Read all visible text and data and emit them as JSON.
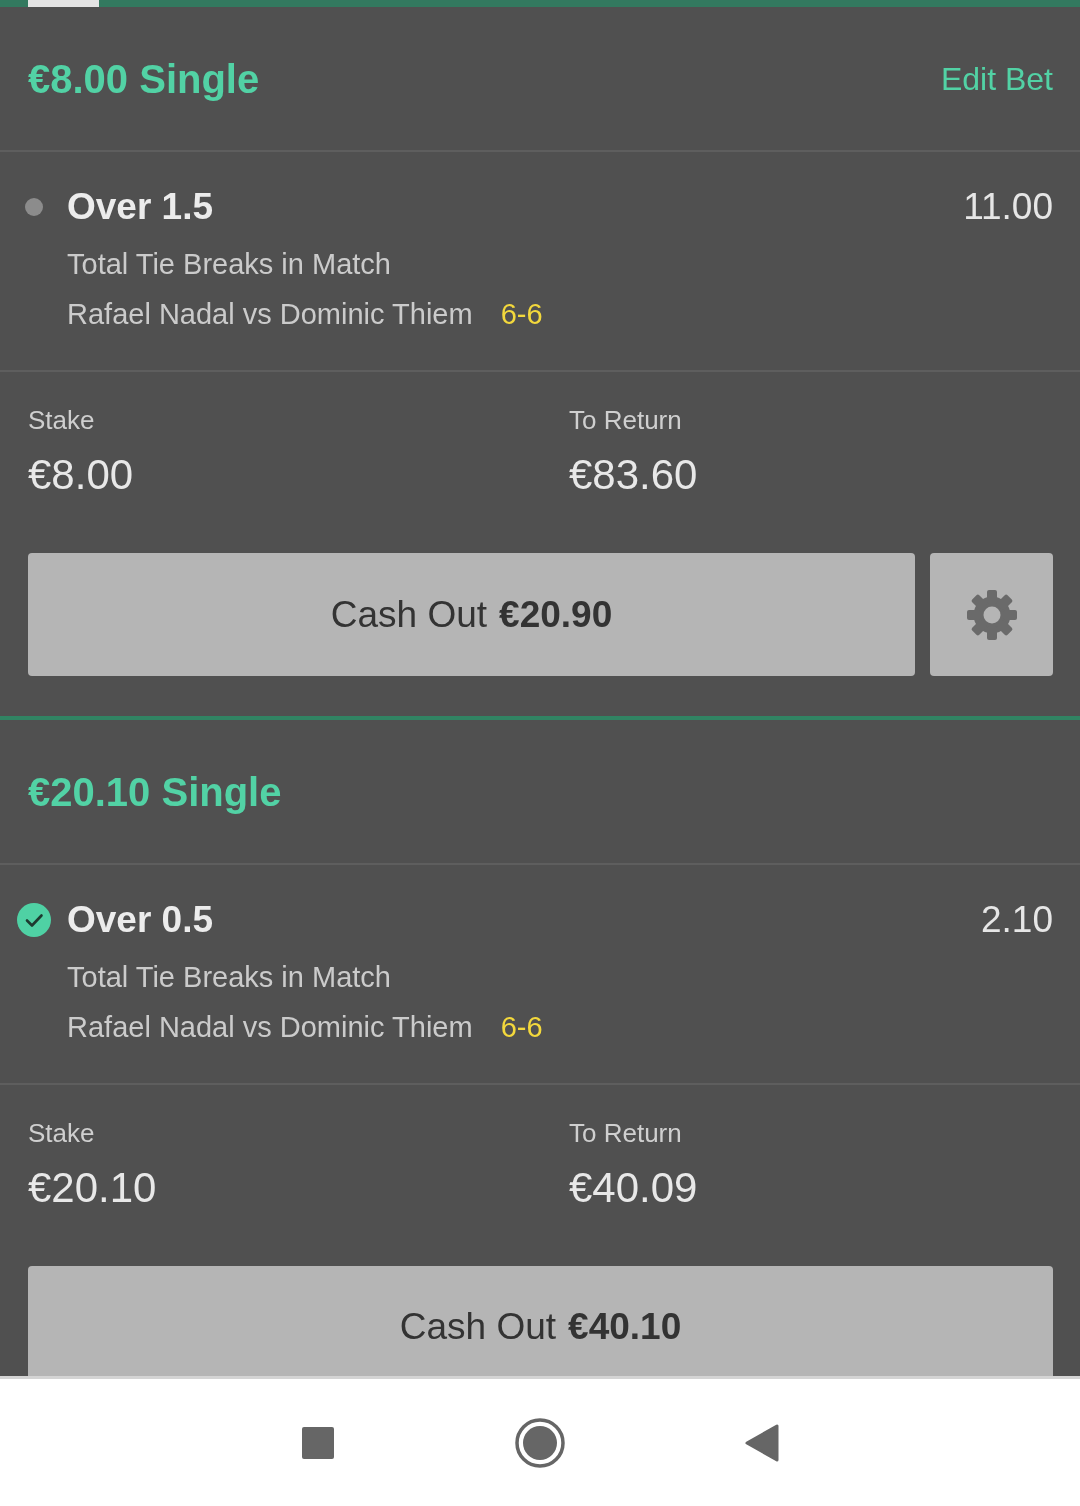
{
  "bets": [
    {
      "title": "€8.00 Single",
      "edit_link": "Edit Bet",
      "selection": {
        "name": "Over 1.5",
        "odds": "11.00",
        "market": "Total Tie Breaks in Match",
        "event": "Rafael Nadal vs Dominic Thiem",
        "score": "6-6",
        "won": false
      },
      "stake": {
        "label": "Stake",
        "value": "€8.00"
      },
      "to_return": {
        "label": "To Return",
        "value": "€83.60"
      },
      "cash_out": "Cash Out **€20.90**",
      "settings_button": true
    },
    {
      "title": "€20.10 Single",
      "selection": {
        "name": "Over 0.5",
        "odds": "2.10",
        "market": "Total Tie Breaks in Match",
        "event": "Rafael Nadal vs Dominic Thiem",
        "score": "6-6",
        "won": true
      },
      "stake": {
        "label": "Stake",
        "value": "€20.10"
      },
      "to_return": {
        "label": "To Return",
        "value": "€40.09"
      },
      "cash_out": "Cash Out **€40.10**",
      "settings_button": false
    }
  ]
}
